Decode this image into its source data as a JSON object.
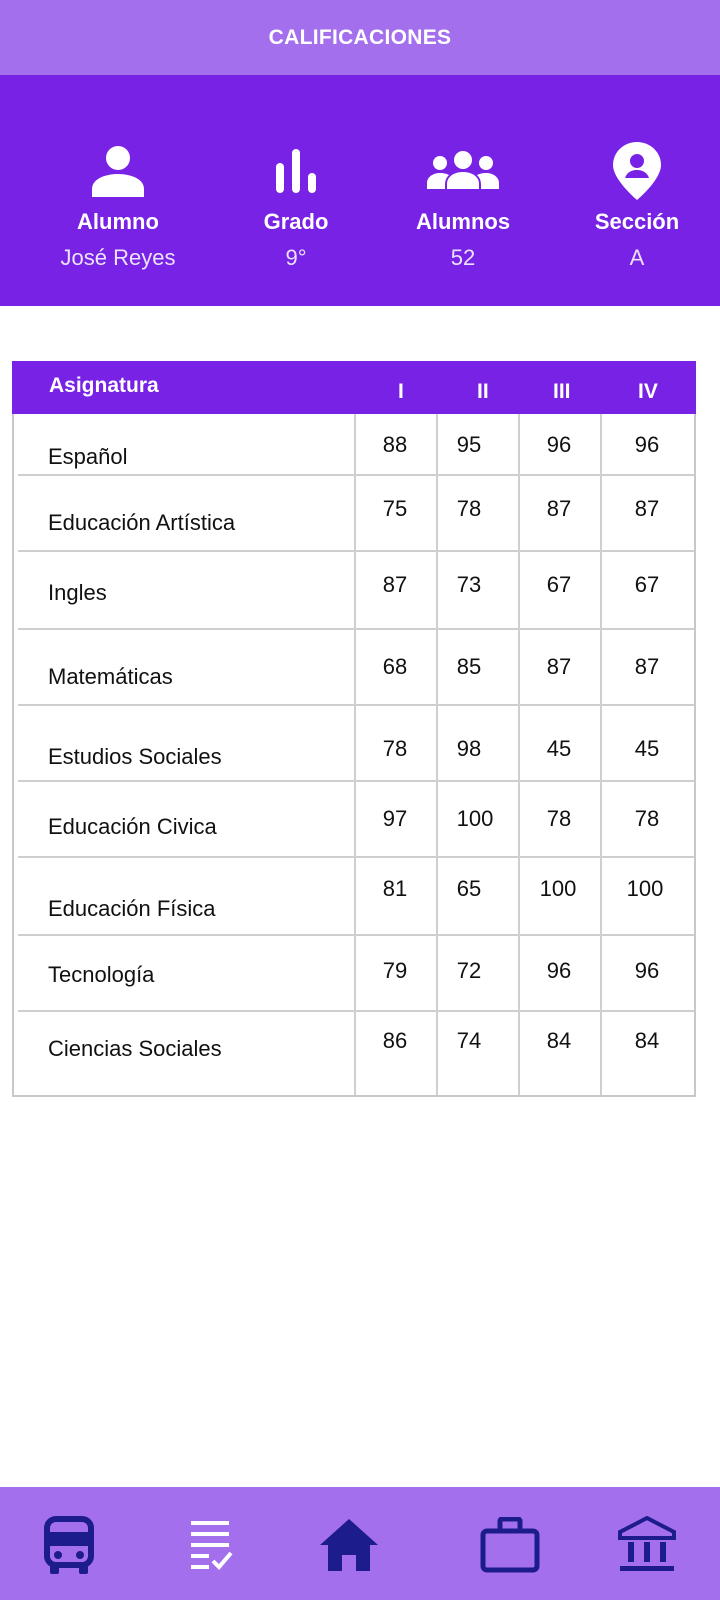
{
  "header": {
    "title": "CALIFICACIONES"
  },
  "info": {
    "student": {
      "icon": "person-icon",
      "label": "Alumno",
      "value": "José Reyes"
    },
    "grade": {
      "icon": "bar-chart-icon",
      "label": "Grado",
      "value": "9°"
    },
    "students": {
      "icon": "group-icon",
      "label": "Alumnos",
      "value": "52"
    },
    "section": {
      "icon": "location-person-icon",
      "label": "Sección",
      "value": "A"
    }
  },
  "table": {
    "headers": {
      "subject": "Asignatura",
      "p1": "I",
      "p2": "II",
      "p3": "III",
      "p4": "IV"
    },
    "rows": [
      {
        "subject": "Español",
        "p1": "88",
        "p2": "95",
        "p3": "96",
        "p4": "96"
      },
      {
        "subject": "Educación Artística",
        "p1": "75",
        "p2": "78",
        "p3": "87",
        "p4": "87"
      },
      {
        "subject": "Ingles",
        "p1": "87",
        "p2": "73",
        "p3": "67",
        "p4": "67"
      },
      {
        "subject": "Matemáticas",
        "p1": "68",
        "p2": "85",
        "p3": "87",
        "p4": "87"
      },
      {
        "subject": "Estudios Sociales",
        "p1": "78",
        "p2": "98",
        "p3": "45",
        "p4": "45"
      },
      {
        "subject": "Educación Civica",
        "p1": "97",
        "p2": "100",
        "p3": "78",
        "p4": "78"
      },
      {
        "subject": "Educación Física",
        "p1": "81",
        "p2": "65",
        "p3": "100",
        "p4": "100"
      },
      {
        "subject": "Tecnología",
        "p1": "79",
        "p2": "72",
        "p3": "96",
        "p4": "96"
      },
      {
        "subject": "Ciencias Sociales",
        "p1": "86",
        "p2": "74",
        "p3": "84",
        "p4": "84"
      }
    ]
  },
  "nav": {
    "items": [
      {
        "icon": "bus-icon"
      },
      {
        "icon": "checklist-icon"
      },
      {
        "icon": "home-icon"
      },
      {
        "icon": "briefcase-icon"
      },
      {
        "icon": "institution-icon"
      }
    ]
  },
  "colors": {
    "primary": "#7722e4",
    "primary_light": "#a46fed",
    "nav_icon": "#1c1c8c",
    "grid": "#cfcfcf"
  }
}
